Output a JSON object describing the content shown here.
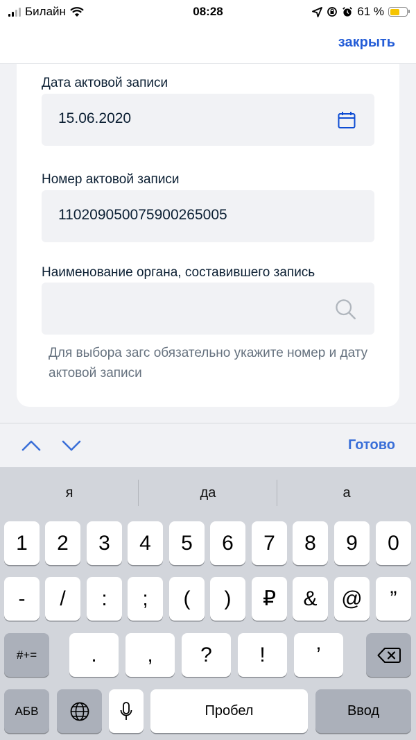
{
  "status_bar": {
    "carrier": "Билайн",
    "time": "08:28",
    "battery": "61 %"
  },
  "header": {
    "close": "закрыть"
  },
  "form": {
    "date_label": "Дата актовой записи",
    "date_value": "15.06.2020",
    "number_label": "Номер актовой записи",
    "number_value": "110209050075900265005",
    "organ_label": "Наименование органа, составившего запись",
    "organ_value": "",
    "hint": "Для выбора загс обязательно укажите номер и дату актовой записи"
  },
  "accessory": {
    "done": "Готово"
  },
  "keyboard": {
    "suggestions": [
      "я",
      "да",
      "а"
    ],
    "row1": [
      "1",
      "2",
      "3",
      "4",
      "5",
      "6",
      "7",
      "8",
      "9",
      "0"
    ],
    "row2": [
      "-",
      "/",
      ":",
      ";",
      "(",
      ")",
      "₽",
      "&",
      "@",
      "”"
    ],
    "row3": [
      ".",
      ",",
      "?",
      "!",
      "’"
    ],
    "symbols_key": "#+=",
    "abc_key": "АБВ",
    "space": "Пробел",
    "enter": "Ввод"
  },
  "colors": {
    "accent": "#0d4cd3",
    "field_bg": "#f1f2f5",
    "keyboard_bg": "#d2d5db"
  }
}
